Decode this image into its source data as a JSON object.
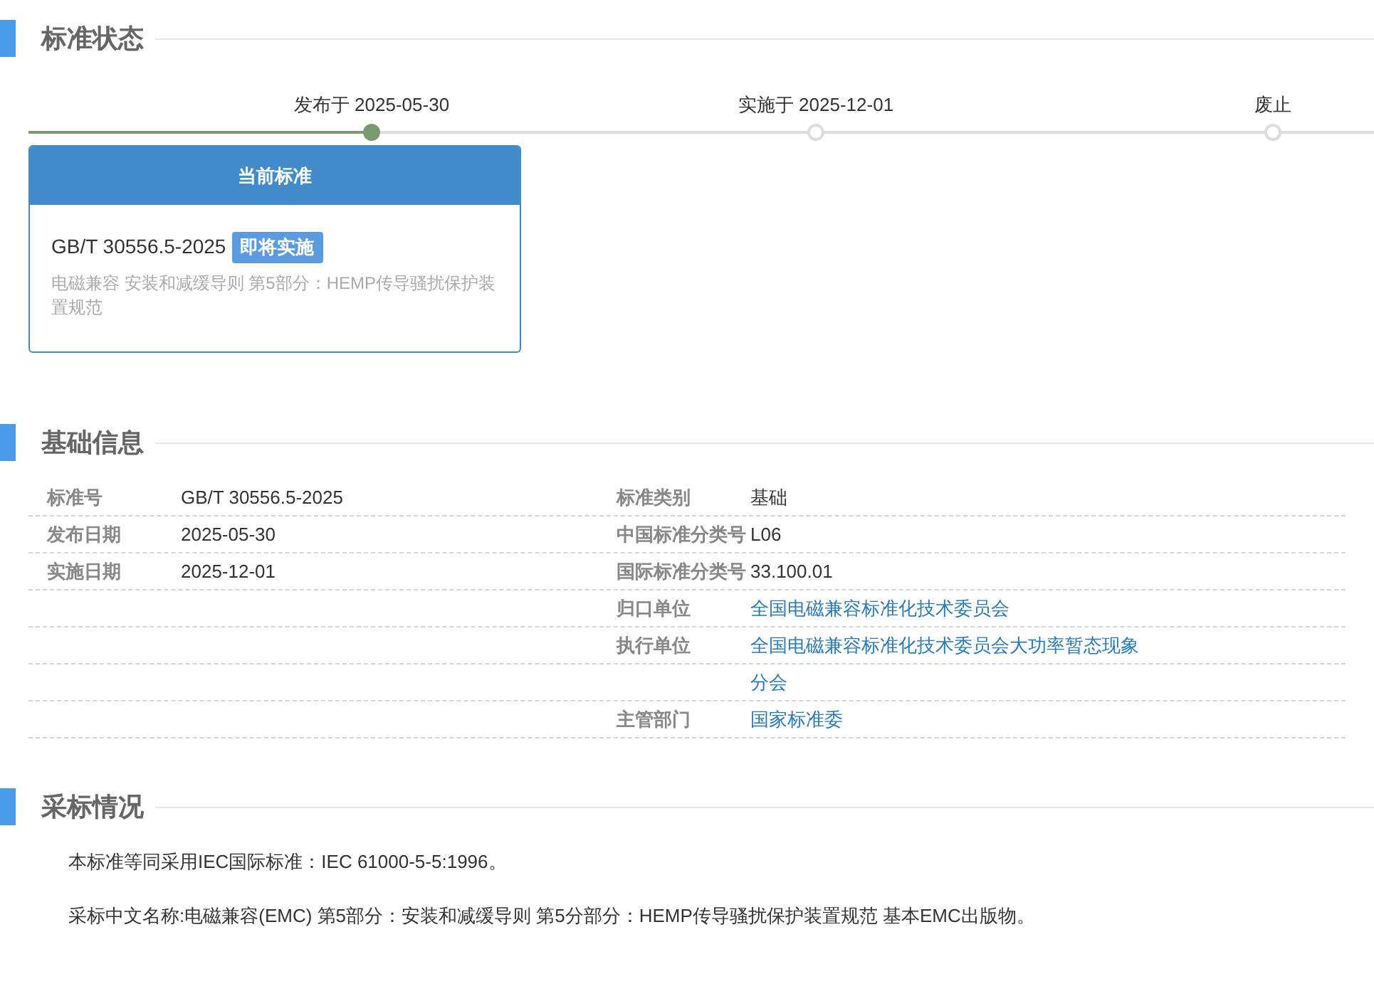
{
  "status_section": {
    "title": "标准状态",
    "timeline": [
      {
        "label": "发布于 2025-05-30",
        "reached": true
      },
      {
        "label": "实施于 2025-12-01",
        "reached": false
      },
      {
        "label": "废止",
        "reached": false
      }
    ],
    "card": {
      "header": "当前标准",
      "code": "GB/T 30556.5-2025",
      "badge": "即将实施",
      "description": "电磁兼容 安装和减缓导则 第5部分：HEMP传导骚扰保护装置规范"
    }
  },
  "basic_info": {
    "title": "基础信息",
    "rows": [
      {
        "left": {
          "label": "标准号",
          "value": "GB/T 30556.5-2025"
        },
        "right": {
          "label": "标准类别",
          "value": "基础",
          "kind": "text"
        }
      },
      {
        "left": {
          "label": "发布日期",
          "value": "2025-05-30"
        },
        "right": {
          "label": "中国标准分类号",
          "value": "L06",
          "kind": "text"
        }
      },
      {
        "left": {
          "label": "实施日期",
          "value": "2025-12-01"
        },
        "right": {
          "label": "国际标准分类号",
          "value": "33.100.01",
          "kind": "text"
        }
      },
      {
        "right": {
          "label": "归口单位",
          "value": "全国电磁兼容标准化技术委员会",
          "kind": "link"
        }
      },
      {
        "right": {
          "label": "执行单位",
          "value": "全国电磁兼容标准化技术委员会大功率暂态现象分会",
          "kind": "link"
        }
      },
      {
        "right": {
          "label": "主管部门",
          "value": "国家标准委",
          "kind": "link"
        }
      }
    ]
  },
  "adoption": {
    "title": "采标情况",
    "paragraphs": [
      "本标准等同采用IEC国际标准：IEC 61000-5-5:1996。",
      "采标中文名称:电磁兼容(EMC) 第5部分：安装和减缓导则 第5分部分：HEMP传导骚扰保护装置规范 基本EMC出版物。"
    ]
  }
}
